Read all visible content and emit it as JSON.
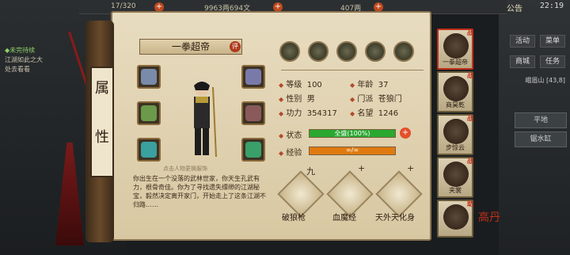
{
  "topbar": {
    "energy": "17/320",
    "silver": "9963两694文",
    "coins": "407两",
    "announce": "公告",
    "clock": "22:19"
  },
  "left_panel": {
    "note_title": "◆未完待续",
    "note_line1": "江湖如此之大",
    "note_line2": "处去看看"
  },
  "right_panel": {
    "buttons": [
      "活动",
      "菜单",
      "商城",
      "任务"
    ],
    "location": "峨眉山",
    "coord": "[43,8]",
    "items": [
      "平地",
      "锯水缸"
    ]
  },
  "scroll": {
    "side_title": [
      "属",
      "性"
    ],
    "name": "一拳超帝",
    "name_tag": "评",
    "hint": "点击人物更换服饰",
    "description": "你出生在一个没落的武林世家，你天生孔武有力，根骨奇佳。你为了寻找遗失缥缈的江湖秘宝，毅然决定离开家门，开始走上了这条江湖不归路……"
  },
  "stats": {
    "level_label": "等级",
    "level": "100",
    "age_label": "年龄",
    "age": "37",
    "gender_label": "性别",
    "gender": "男",
    "sect_label": "门派",
    "sect": "苍狼门",
    "power_label": "功力",
    "power": "354317",
    "fame_label": "名望",
    "fame": "1246",
    "status_label": "状态",
    "status_text": "全盛(100%)",
    "status_pct": 100,
    "exp_label": "经验",
    "exp_text": "∞/∞",
    "exp_pct": 100
  },
  "skills": [
    {
      "name": "破狼枪",
      "level": "九"
    },
    {
      "name": "血魔经",
      "level": "+"
    },
    {
      "name": "天外天化身",
      "level": "+"
    }
  ],
  "party": [
    {
      "name": "一拳超帝",
      "badge": "战"
    },
    {
      "name": "商昊乾",
      "badge": "战"
    },
    {
      "name": "步惊云",
      "badge": "战"
    },
    {
      "name": "夹裳",
      "badge": "战"
    },
    {
      "name": "",
      "badge": "助"
    }
  ],
  "seal": "高丹",
  "colors": {
    "accent": "#c0301a",
    "hp": "#2aa830",
    "exp": "#e07a10"
  }
}
